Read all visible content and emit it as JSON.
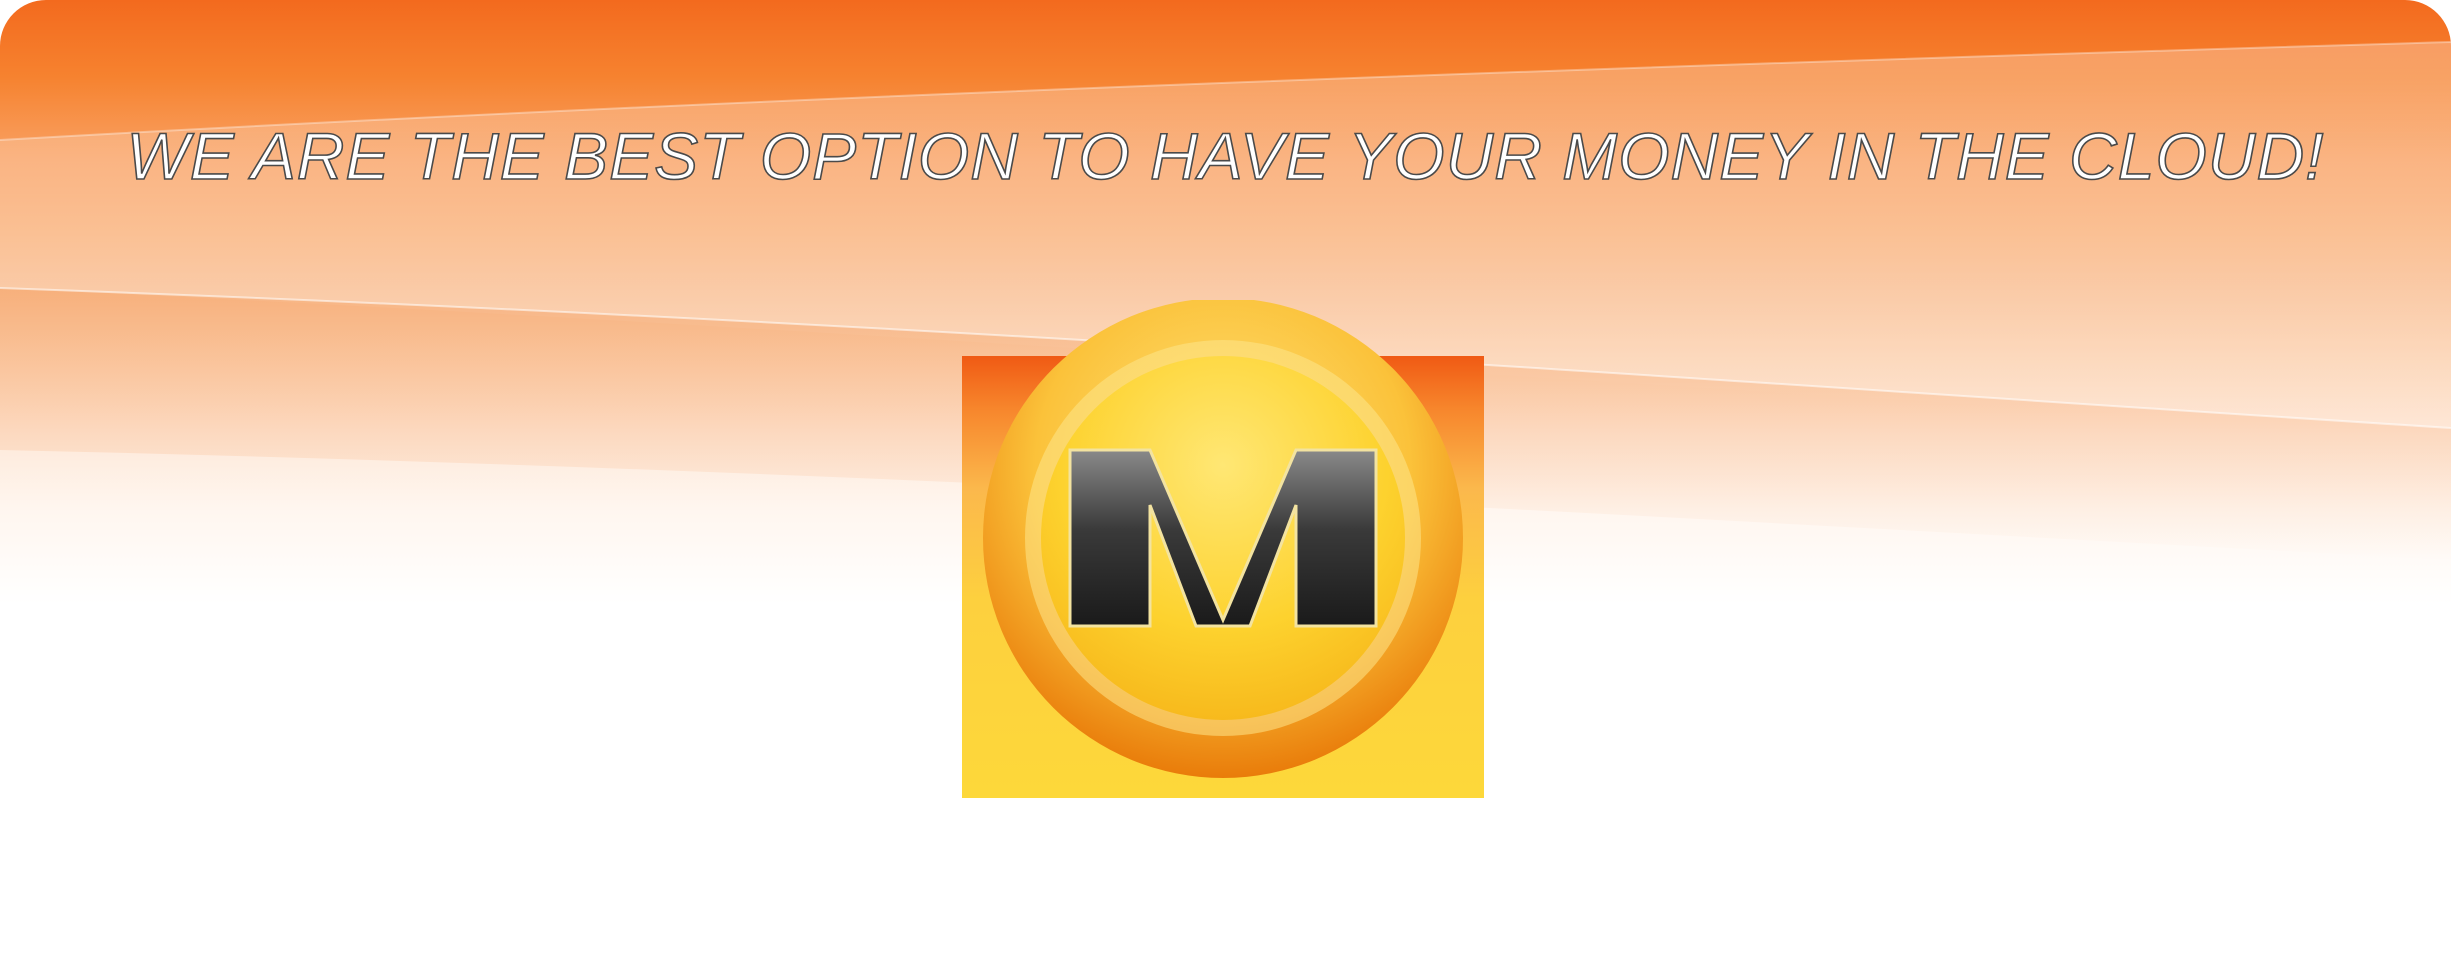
{
  "banner": {
    "headline": "WE ARE THE BEST OPTION TO HAVE YOUR MONEY IN THE CLOUD!",
    "logo_letter": "M"
  },
  "icons": [
    "coin-logo-icon"
  ],
  "colors": {
    "orange_top": "#f36a1e",
    "orange_mid": "#f9a366",
    "peach": "#fcd6b8",
    "coin_gold": "#fdd22e",
    "coin_rim": "#e97c0a",
    "letter_dark": "#222222",
    "text_outline": "#4a4a4a"
  }
}
